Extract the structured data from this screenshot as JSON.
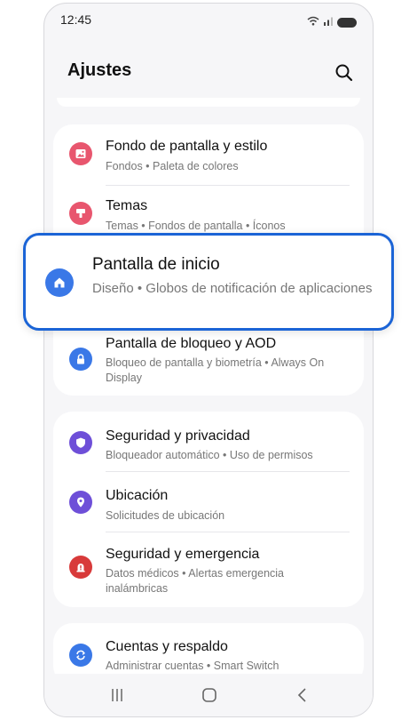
{
  "status": {
    "time": "12:45"
  },
  "header": {
    "title": "Ajustes"
  },
  "group1": [
    {
      "title": "Fondo de pantalla y estilo",
      "subtitle": "Fondos  •  Paleta de colores",
      "icon": "image-icon",
      "color": "#e8566e"
    },
    {
      "title": "Temas",
      "subtitle": "Temas  •  Fondos de pantalla  •  Íconos",
      "icon": "brush-icon",
      "color": "#e8566e"
    },
    {
      "title": "Pantalla de bloqueo y AOD",
      "subtitle": "Bloqueo de pantalla y biometría  •  Always On Display",
      "icon": "lock-icon",
      "color": "#3a78e7"
    }
  ],
  "popup": {
    "title": "Pantalla de inicio",
    "subtitle": "Diseño  •  Globos de notificación de aplicaciones",
    "icon": "home-icon",
    "color": "#3a78e7"
  },
  "group2": [
    {
      "title": "Seguridad y privacidad",
      "subtitle": "Bloqueador automático  •  Uso de permisos",
      "icon": "shield-icon",
      "color": "#6e4fd8"
    },
    {
      "title": "Ubicación",
      "subtitle": "Solicitudes de ubicación",
      "icon": "location-pin-icon",
      "color": "#6e4fd8"
    },
    {
      "title": "Seguridad y emergencia",
      "subtitle": "Datos médicos  •  Alertas emergencia inalámbricas",
      "icon": "emergency-icon",
      "color": "#d83a3a"
    }
  ],
  "group3": [
    {
      "title": "Cuentas y respaldo",
      "subtitle": "Administrar cuentas  •  Smart Switch",
      "icon": "sync-icon",
      "color": "#3a78e7"
    }
  ],
  "navbar": {
    "buttons": [
      "recent-apps",
      "home",
      "back"
    ]
  }
}
